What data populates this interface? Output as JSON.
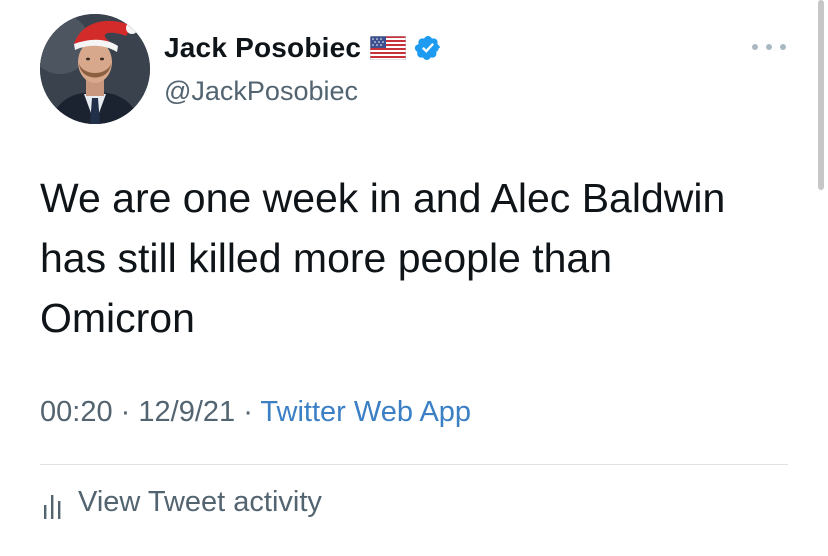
{
  "author": {
    "display_name": "Jack Posobiec",
    "handle": "@JackPosobiec"
  },
  "icons": {
    "avatar": "profile-photo-santa-hat",
    "flag": "us-flag-emoji",
    "verified": "verified-badge-icon",
    "more": "more-options-icon",
    "activity": "bar-chart-icon"
  },
  "tweet": {
    "lines": [
      "We are one week in and Alec Baldwin",
      "has still killed more people than",
      "Omicron"
    ]
  },
  "meta": {
    "time": "00:20",
    "separator": "·",
    "date": "12/9/21",
    "source": "Twitter Web App"
  },
  "activity": {
    "label": "View Tweet activity"
  },
  "colors": {
    "text": "#0f1419",
    "secondary": "#536471",
    "link": "#3b7fc4",
    "verified": "#1d9bf0",
    "divider": "#dfe3e6"
  }
}
